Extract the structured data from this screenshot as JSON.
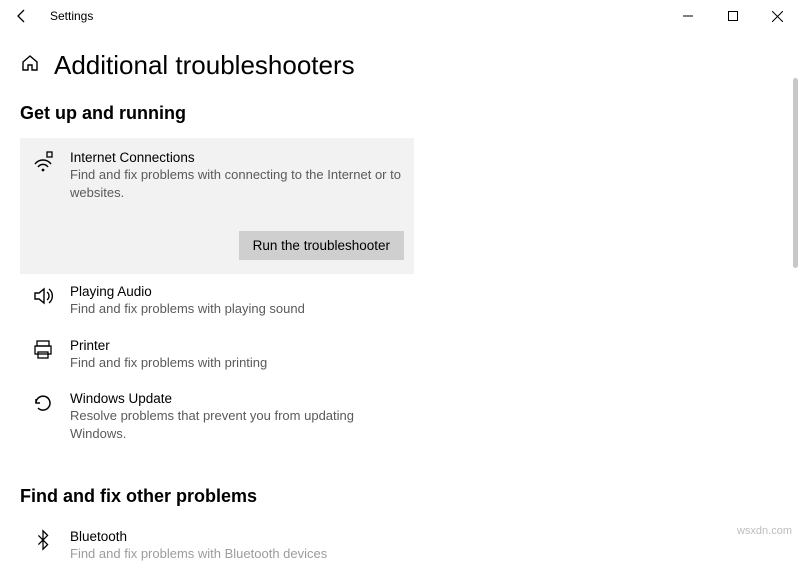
{
  "window": {
    "title": "Settings",
    "page_title": "Additional troubleshooters"
  },
  "sections": {
    "running_header": "Get up and running",
    "other_header": "Find and fix other problems"
  },
  "items": {
    "internet": {
      "title": "Internet Connections",
      "desc": "Find and fix problems with connecting to the Internet or to websites.",
      "run_label": "Run the troubleshooter"
    },
    "audio": {
      "title": "Playing Audio",
      "desc": "Find and fix problems with playing sound"
    },
    "printer": {
      "title": "Printer",
      "desc": "Find and fix problems with printing"
    },
    "update": {
      "title": "Windows Update",
      "desc": "Resolve problems that prevent you from updating Windows."
    },
    "bluetooth": {
      "title": "Bluetooth",
      "desc": "Find and fix problems with Bluetooth devices"
    }
  },
  "watermark": "wsxdn.com"
}
